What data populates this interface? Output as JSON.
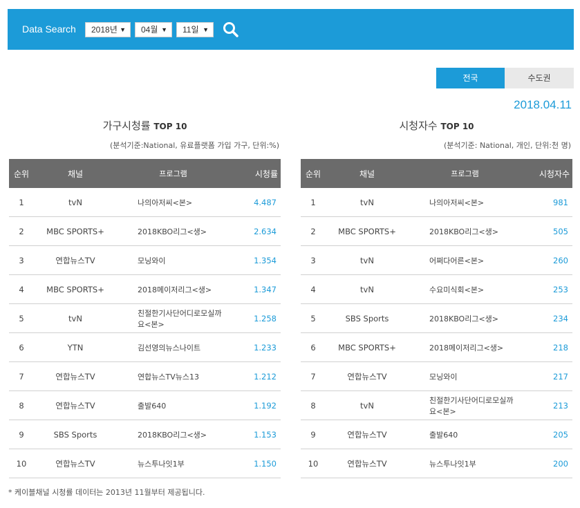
{
  "search": {
    "label": "Data Search",
    "year": "2018년",
    "month": "04월",
    "day": "11일",
    "search_icon": "search-icon"
  },
  "tabs": {
    "national": "전국",
    "capital": "수도권"
  },
  "date": "2018.04.11",
  "household": {
    "title": "가구시청률",
    "title_suffix": "TOP 10",
    "subtitle": "(분석기준:National, 유료플랫폼 가입 가구, 단위:%)",
    "headers": {
      "rank": "순위",
      "channel": "채널",
      "program": "프로그램",
      "value": "시청률"
    },
    "rows": [
      {
        "rank": "1",
        "channel": "tvN",
        "program": "나의아저씨<본>",
        "value": "4.487"
      },
      {
        "rank": "2",
        "channel": "MBC SPORTS+",
        "program": "2018KBO리그<생>",
        "value": "2.634"
      },
      {
        "rank": "3",
        "channel": "연합뉴스TV",
        "program": "모닝와이",
        "value": "1.354"
      },
      {
        "rank": "4",
        "channel": "MBC SPORTS+",
        "program": "2018메이저리그<생>",
        "value": "1.347"
      },
      {
        "rank": "5",
        "channel": "tvN",
        "program": "친절한기사단어디로모실까요<본>",
        "value": "1.258"
      },
      {
        "rank": "6",
        "channel": "YTN",
        "program": "김선영의뉴스나이트",
        "value": "1.233"
      },
      {
        "rank": "7",
        "channel": "연합뉴스TV",
        "program": "연합뉴스TV뉴스13",
        "value": "1.212"
      },
      {
        "rank": "8",
        "channel": "연합뉴스TV",
        "program": "출발640",
        "value": "1.192"
      },
      {
        "rank": "9",
        "channel": "SBS Sports",
        "program": "2018KBO리그<생>",
        "value": "1.153"
      },
      {
        "rank": "10",
        "channel": "연합뉴스TV",
        "program": "뉴스투나잇1부",
        "value": "1.150"
      }
    ]
  },
  "viewers": {
    "title": "시청자수",
    "title_suffix": "TOP 10",
    "subtitle": "(분석기준: National, 개인, 단위:천 명)",
    "headers": {
      "rank": "순위",
      "channel": "채널",
      "program": "프로그램",
      "value": "시청자수"
    },
    "rows": [
      {
        "rank": "1",
        "channel": "tvN",
        "program": "나의아저씨<본>",
        "value": "981"
      },
      {
        "rank": "2",
        "channel": "MBC SPORTS+",
        "program": "2018KBO리그<생>",
        "value": "505"
      },
      {
        "rank": "3",
        "channel": "tvN",
        "program": "어쩌다어른<본>",
        "value": "260"
      },
      {
        "rank": "4",
        "channel": "tvN",
        "program": "수요미식회<본>",
        "value": "253"
      },
      {
        "rank": "5",
        "channel": "SBS Sports",
        "program": "2018KBO리그<생>",
        "value": "234"
      },
      {
        "rank": "6",
        "channel": "MBC SPORTS+",
        "program": "2018메이저리그<생>",
        "value": "218"
      },
      {
        "rank": "7",
        "channel": "연합뉴스TV",
        "program": "모닝와이",
        "value": "217"
      },
      {
        "rank": "8",
        "channel": "tvN",
        "program": "친절한기사단어디로모실까요<본>",
        "value": "213"
      },
      {
        "rank": "9",
        "channel": "연합뉴스TV",
        "program": "출발640",
        "value": "205"
      },
      {
        "rank": "10",
        "channel": "연합뉴스TV",
        "program": "뉴스투나잇1부",
        "value": "200"
      }
    ]
  },
  "footnote": "* 케이블채널 시청률 데이터는 2013년 11월부터 제공됩니다.",
  "colors": {
    "accent": "#1c9bd8",
    "header_bg": "#6b6b6b",
    "tab_inactive": "#e9e9e9"
  }
}
